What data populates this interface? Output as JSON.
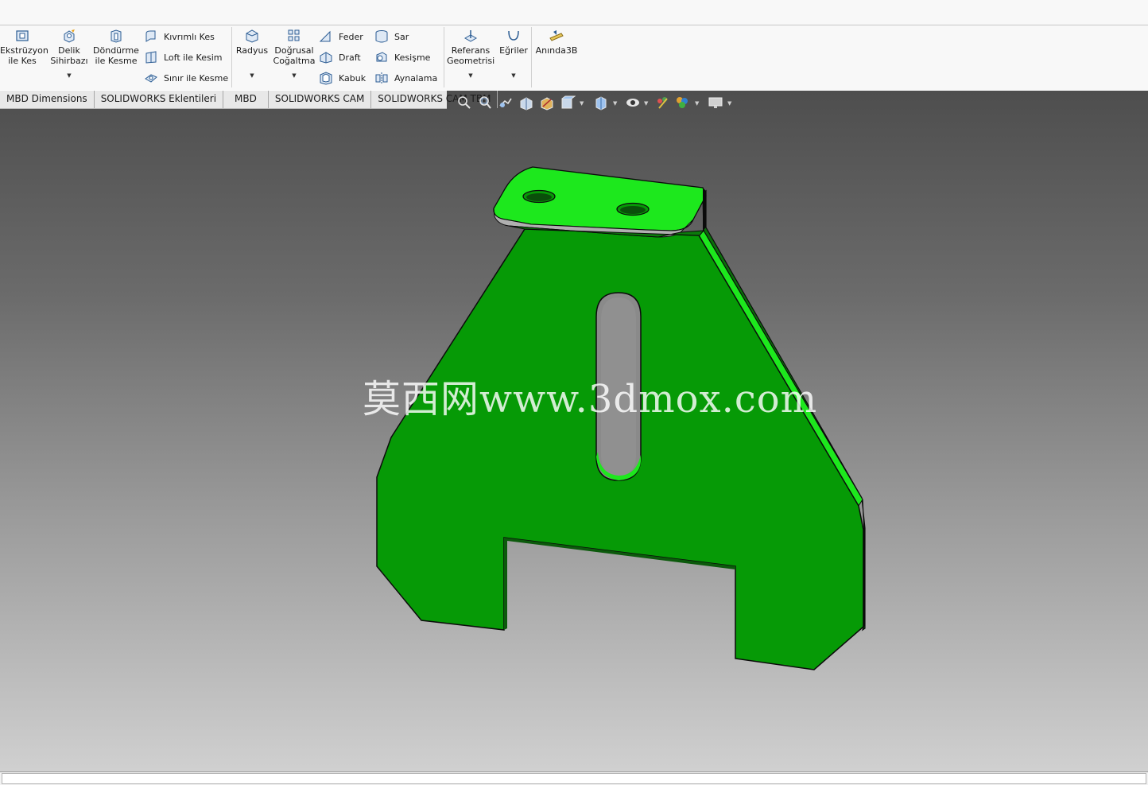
{
  "ribbon": {
    "extrude_cut": "Ekstrüzyon\nile Kes",
    "hole_wizard": "Delik\nSihirbazı",
    "revolved_cut": "Döndürme\nile Kesme",
    "swept_cut": "Kıvrımlı Kes",
    "lofted_cut": "Loft ile Kesim",
    "boundary_cut": "Sınır ile Kesme",
    "fillet": "Radyus",
    "linear_pattern": "Doğrusal\nCoğaltma",
    "rib": "Feder",
    "draft": "Draft",
    "shell": "Kabuk",
    "wrap": "Sar",
    "intersect": "Kesişme",
    "mirror": "Aynalama",
    "reference_geometry": "Referans\nGeometrisi",
    "curves": "Eğriler",
    "instant3d": "Anında3B"
  },
  "tabs": [
    {
      "label": "MBD Dimensions"
    },
    {
      "label": "SOLIDWORKS Eklentileri"
    },
    {
      "label": "MBD"
    },
    {
      "label": "SOLIDWORKS CAM"
    },
    {
      "label": "SOLIDWORKS CAM TBM"
    }
  ],
  "heads_up_toolbar": [
    "zoom-to-fit-icon",
    "zoom-to-area-icon",
    "previous-view-icon",
    "section-view-icon",
    "dynamic-annotation-icon",
    "view-orientation-icon",
    "display-style-icon",
    "hide-show-items-icon",
    "edit-appearance-icon",
    "apply-scene-icon",
    "view-settings-icon"
  ],
  "watermark": "莫西网www.3dmox.com",
  "colors": {
    "part_face": "#069a06",
    "part_light": "#1de81d",
    "part_edge": "#0b0b0b",
    "viewport_top": "#4e4e4e",
    "viewport_bottom": "#d0d0d0"
  }
}
